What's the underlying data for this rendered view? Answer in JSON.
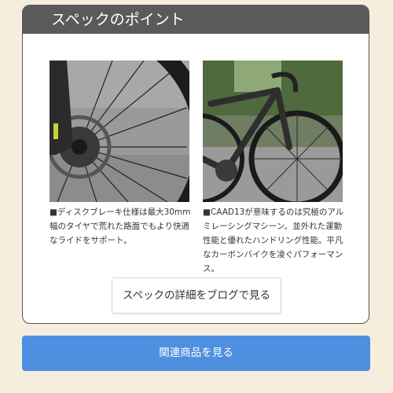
{
  "section": {
    "title": "スペックのポイント"
  },
  "points": [
    {
      "caption": "■ディスクブレーキ仕様は最大30mm幅のタイヤで荒れた路面でもより快適なライドをサポート。"
    },
    {
      "caption": "■CAAD13が意味するのは究極のアルミレーシングマシーン。並外れた運動性能と優れたハンドリング性能。平凡なカーボンバイクを凌ぐパフォーマンス。"
    }
  ],
  "buttons": {
    "spec_details": "スペックの詳細をブログで見る",
    "related_products": "関連商品を見る"
  },
  "colors": {
    "page_background": "#f5eedc",
    "header_background": "#5a5a5a",
    "accent_button": "#4f8fe0"
  }
}
